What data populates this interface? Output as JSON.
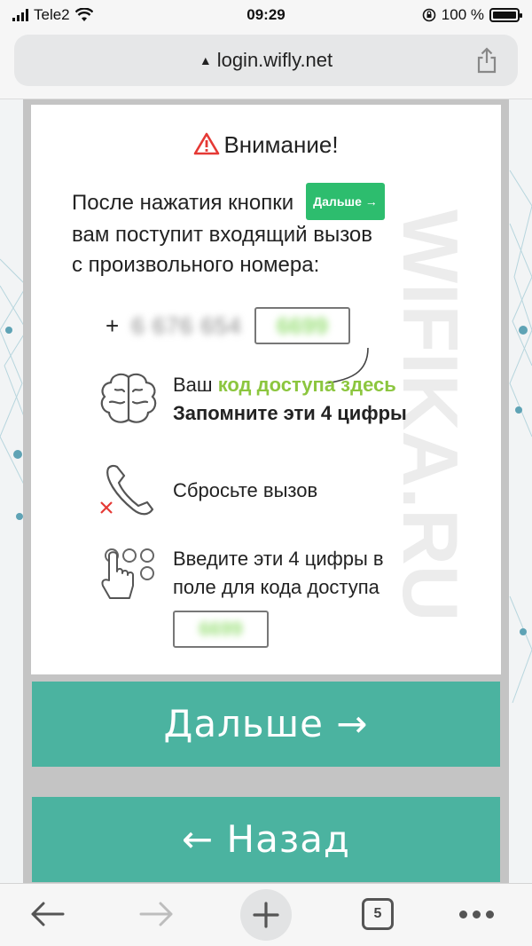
{
  "status": {
    "carrier": "Tele2",
    "time": "09:29",
    "battery": "100 %"
  },
  "browser": {
    "url": "login.wifly.net",
    "tabs_count": "5"
  },
  "card": {
    "title": "Внимание!",
    "intro_line1": "После нажатия кнопки",
    "intro_mini_button": "Дальше →",
    "intro_line2": "вам поступит входящий вызов",
    "intro_line3": "с произвольного номера:",
    "phone_prefix": "+",
    "phone_number": "6 676 654",
    "phone_code": "6699",
    "step1_prefix": "Ваш",
    "step1_highlight": "код доступа здесь",
    "step1_line2": "Запомните эти 4 цифры",
    "step2": "Сбросьте вызов",
    "step3_line1": "Введите эти 4 цифры в",
    "step3_line2": "поле для кода доступа",
    "step3_code": "6699",
    "watermark": "WIFIKA.RU"
  },
  "buttons": {
    "next": "Дальше →",
    "back": "← Назад"
  },
  "colors": {
    "accent": "#4bb3a0",
    "green": "#8cc63f",
    "mini_button": "#2dbd6e",
    "warning": "#e53935"
  }
}
